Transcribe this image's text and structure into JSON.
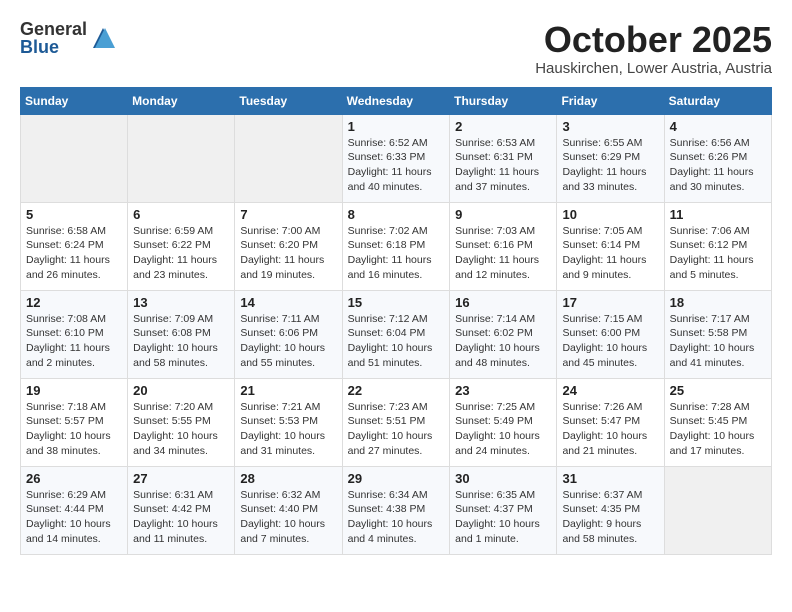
{
  "header": {
    "logo_general": "General",
    "logo_blue": "Blue",
    "month_title": "October 2025",
    "subtitle": "Hauskirchen, Lower Austria, Austria"
  },
  "columns": [
    "Sunday",
    "Monday",
    "Tuesday",
    "Wednesday",
    "Thursday",
    "Friday",
    "Saturday"
  ],
  "weeks": [
    [
      {
        "day": "",
        "info": ""
      },
      {
        "day": "",
        "info": ""
      },
      {
        "day": "",
        "info": ""
      },
      {
        "day": "1",
        "info": "Sunrise: 6:52 AM\nSunset: 6:33 PM\nDaylight: 11 hours\nand 40 minutes."
      },
      {
        "day": "2",
        "info": "Sunrise: 6:53 AM\nSunset: 6:31 PM\nDaylight: 11 hours\nand 37 minutes."
      },
      {
        "day": "3",
        "info": "Sunrise: 6:55 AM\nSunset: 6:29 PM\nDaylight: 11 hours\nand 33 minutes."
      },
      {
        "day": "4",
        "info": "Sunrise: 6:56 AM\nSunset: 6:26 PM\nDaylight: 11 hours\nand 30 minutes."
      }
    ],
    [
      {
        "day": "5",
        "info": "Sunrise: 6:58 AM\nSunset: 6:24 PM\nDaylight: 11 hours\nand 26 minutes."
      },
      {
        "day": "6",
        "info": "Sunrise: 6:59 AM\nSunset: 6:22 PM\nDaylight: 11 hours\nand 23 minutes."
      },
      {
        "day": "7",
        "info": "Sunrise: 7:00 AM\nSunset: 6:20 PM\nDaylight: 11 hours\nand 19 minutes."
      },
      {
        "day": "8",
        "info": "Sunrise: 7:02 AM\nSunset: 6:18 PM\nDaylight: 11 hours\nand 16 minutes."
      },
      {
        "day": "9",
        "info": "Sunrise: 7:03 AM\nSunset: 6:16 PM\nDaylight: 11 hours\nand 12 minutes."
      },
      {
        "day": "10",
        "info": "Sunrise: 7:05 AM\nSunset: 6:14 PM\nDaylight: 11 hours\nand 9 minutes."
      },
      {
        "day": "11",
        "info": "Sunrise: 7:06 AM\nSunset: 6:12 PM\nDaylight: 11 hours\nand 5 minutes."
      }
    ],
    [
      {
        "day": "12",
        "info": "Sunrise: 7:08 AM\nSunset: 6:10 PM\nDaylight: 11 hours\nand 2 minutes."
      },
      {
        "day": "13",
        "info": "Sunrise: 7:09 AM\nSunset: 6:08 PM\nDaylight: 10 hours\nand 58 minutes."
      },
      {
        "day": "14",
        "info": "Sunrise: 7:11 AM\nSunset: 6:06 PM\nDaylight: 10 hours\nand 55 minutes."
      },
      {
        "day": "15",
        "info": "Sunrise: 7:12 AM\nSunset: 6:04 PM\nDaylight: 10 hours\nand 51 minutes."
      },
      {
        "day": "16",
        "info": "Sunrise: 7:14 AM\nSunset: 6:02 PM\nDaylight: 10 hours\nand 48 minutes."
      },
      {
        "day": "17",
        "info": "Sunrise: 7:15 AM\nSunset: 6:00 PM\nDaylight: 10 hours\nand 45 minutes."
      },
      {
        "day": "18",
        "info": "Sunrise: 7:17 AM\nSunset: 5:58 PM\nDaylight: 10 hours\nand 41 minutes."
      }
    ],
    [
      {
        "day": "19",
        "info": "Sunrise: 7:18 AM\nSunset: 5:57 PM\nDaylight: 10 hours\nand 38 minutes."
      },
      {
        "day": "20",
        "info": "Sunrise: 7:20 AM\nSunset: 5:55 PM\nDaylight: 10 hours\nand 34 minutes."
      },
      {
        "day": "21",
        "info": "Sunrise: 7:21 AM\nSunset: 5:53 PM\nDaylight: 10 hours\nand 31 minutes."
      },
      {
        "day": "22",
        "info": "Sunrise: 7:23 AM\nSunset: 5:51 PM\nDaylight: 10 hours\nand 27 minutes."
      },
      {
        "day": "23",
        "info": "Sunrise: 7:25 AM\nSunset: 5:49 PM\nDaylight: 10 hours\nand 24 minutes."
      },
      {
        "day": "24",
        "info": "Sunrise: 7:26 AM\nSunset: 5:47 PM\nDaylight: 10 hours\nand 21 minutes."
      },
      {
        "day": "25",
        "info": "Sunrise: 7:28 AM\nSunset: 5:45 PM\nDaylight: 10 hours\nand 17 minutes."
      }
    ],
    [
      {
        "day": "26",
        "info": "Sunrise: 6:29 AM\nSunset: 4:44 PM\nDaylight: 10 hours\nand 14 minutes."
      },
      {
        "day": "27",
        "info": "Sunrise: 6:31 AM\nSunset: 4:42 PM\nDaylight: 10 hours\nand 11 minutes."
      },
      {
        "day": "28",
        "info": "Sunrise: 6:32 AM\nSunset: 4:40 PM\nDaylight: 10 hours\nand 7 minutes."
      },
      {
        "day": "29",
        "info": "Sunrise: 6:34 AM\nSunset: 4:38 PM\nDaylight: 10 hours\nand 4 minutes."
      },
      {
        "day": "30",
        "info": "Sunrise: 6:35 AM\nSunset: 4:37 PM\nDaylight: 10 hours\nand 1 minute."
      },
      {
        "day": "31",
        "info": "Sunrise: 6:37 AM\nSunset: 4:35 PM\nDaylight: 9 hours\nand 58 minutes."
      },
      {
        "day": "",
        "info": ""
      }
    ]
  ]
}
